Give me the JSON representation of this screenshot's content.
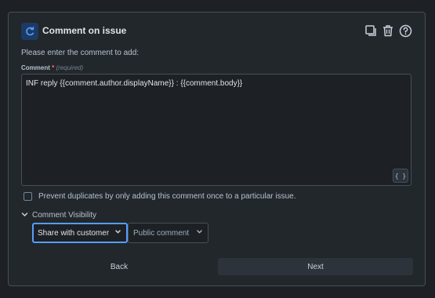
{
  "header": {
    "title": "Comment on issue",
    "icon": "refresh-comment-icon",
    "actions": [
      "duplicate-icon",
      "trash-icon",
      "help-icon"
    ]
  },
  "instruction": "Please enter the comment to add:",
  "comment_field": {
    "label": "Comment",
    "required_marker": "*",
    "hint": "(required)",
    "value": "INF reply {{comment.author.displayName}} : {{comment.body}}",
    "smart_value_button": "{ }"
  },
  "prevent_duplicates": {
    "label": "Prevent duplicates by only adding this comment once to a particular issue.",
    "checked": false
  },
  "visibility": {
    "label": "Comment Visibility",
    "expanded": true,
    "audience_select": "Share with customer",
    "type_select": "Public comment"
  },
  "buttons": {
    "back": "Back",
    "next": "Next"
  },
  "colors": {
    "panel": "#22272b",
    "focus": "#579dff",
    "icon_bg": "#1c3a63"
  }
}
